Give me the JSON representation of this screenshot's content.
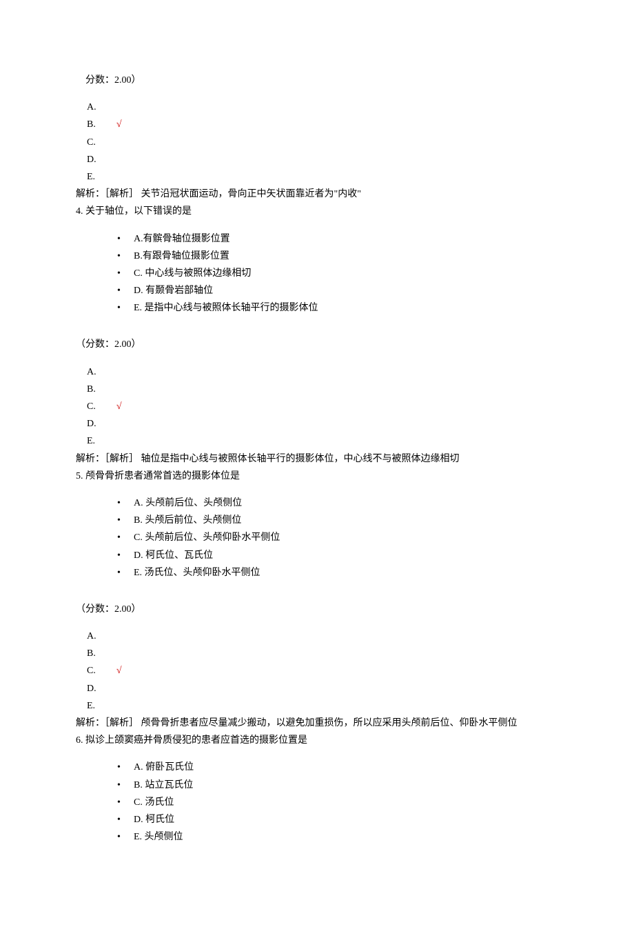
{
  "q3tail": {
    "score_line": "分数：2.00）",
    "answers": {
      "a": "A.",
      "b": "B.",
      "c": "C.",
      "d": "D.",
      "e": "E."
    },
    "correct_key": "b",
    "mark": "√",
    "analysis": "解析：［解析］ 关节沿冠状面运动，骨向正中矢状面靠近者为\"内收\""
  },
  "q4": {
    "stem": "4. 关于轴位，以下错误的是",
    "options": [
      "A.有髌骨轴位摄影位置",
      "B.有跟骨轴位摄影位置",
      "C. 中心线与被照体边缘相切",
      "D. 有颞骨岩部轴位",
      "E. 是指中心线与被照体长轴平行的摄影体位"
    ],
    "score_line": "（分数：2.00）",
    "answers": {
      "a": "A.",
      "b": "B.",
      "c": "C.",
      "d": "D.",
      "e": "E."
    },
    "correct_key": "c",
    "mark": "√",
    "analysis": "解析：［解析］ 轴位是指中心线与被照体长轴平行的摄影体位，中心线不与被照体边缘相切"
  },
  "q5": {
    "stem": "5. 颅骨骨折患者通常首选的摄影体位是",
    "options": [
      "A. 头颅前后位、头颅侧位",
      "B. 头颅后前位、头颅侧位",
      "C. 头颅前后位、头颅仰卧水平侧位",
      "D. 柯氏位、瓦氏位",
      "E. 汤氏位、头颅仰卧水平侧位"
    ],
    "score_line": "（分数：2.00）",
    "answers": {
      "a": "A.",
      "b": "B.",
      "c": "C.",
      "d": "D.",
      "e": "E."
    },
    "correct_key": "c",
    "mark": "√",
    "analysis": "解析：［解析］ 颅骨骨折患者应尽量减少搬动，以避免加重损伤，所以应采用头颅前后位、仰卧水平侧位"
  },
  "q6": {
    "stem": "6. 拟诊上颌窦癌并骨质侵犯的患者应首选的摄影位置是",
    "options": [
      "A. 俯卧瓦氏位",
      "B. 站立瓦氏位",
      "C. 汤氏位",
      "D. 柯氏位",
      "E. 头颅侧位"
    ]
  }
}
